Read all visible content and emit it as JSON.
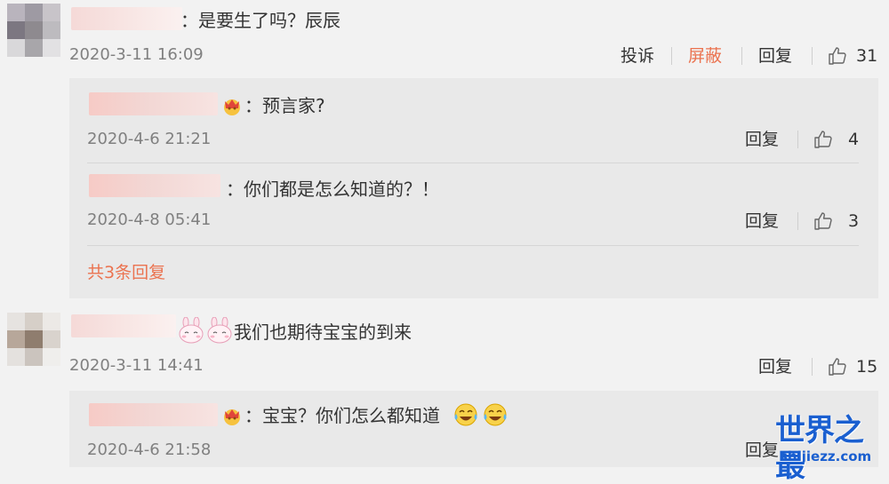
{
  "colors": {
    "accent": "#eb7350",
    "text": "#333333",
    "meta": "#808080",
    "reply_bg": "#e9e9e9",
    "watermark": "#1a5fd0"
  },
  "comments": [
    {
      "text": "：是要生了吗？辰辰",
      "date": "2020-3-11 16:09",
      "actions": {
        "report": "投诉",
        "block": "屏蔽",
        "reply": "回复"
      },
      "likes": "31",
      "replies": [
        {
          "text": "：预言家?",
          "date": "2020-4-6 21:21",
          "reply": "回复",
          "likes": "4"
        },
        {
          "text": "：你们都是怎么知道的？！",
          "date": "2020-4-8 05:41",
          "reply": "回复",
          "likes": "3"
        }
      ],
      "more": "共3条回复"
    },
    {
      "text": "我们也期待宝宝的到来",
      "date": "2020-3-11 14:41",
      "actions": {
        "reply": "回复"
      },
      "likes": "15",
      "replies": [
        {
          "text": "：宝宝？你们怎么都知道",
          "date": "2020-4-6 21:58",
          "reply": "回复"
        }
      ]
    }
  ],
  "watermark": {
    "title": "世界之最",
    "url": "shijiezz.com"
  }
}
